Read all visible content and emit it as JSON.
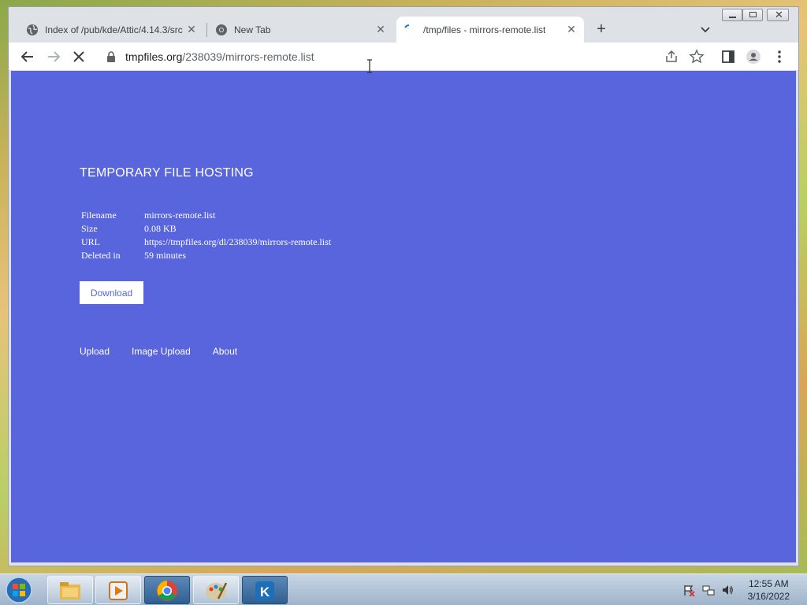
{
  "browser": {
    "tabs": [
      {
        "title": "Index of /pub/kde/Attic/4.14.3/src",
        "favicon": "globe-icon",
        "active": false
      },
      {
        "title": "New Tab",
        "favicon": "chrome-icon",
        "active": false
      },
      {
        "title": "/tmp/files - mirrors-remote.list",
        "favicon": "loading-spinner-icon",
        "active": true
      }
    ],
    "address": {
      "host": "tmpfiles.org",
      "path": "/238039/mirrors-remote.list"
    }
  },
  "page": {
    "title": "TEMPORARY FILE HOSTING",
    "file_info": [
      {
        "label": "Filename",
        "value": "mirrors-remote.list"
      },
      {
        "label": "Size",
        "value": "0.08 KB"
      },
      {
        "label": "URL",
        "value": "https://tmpfiles.org/dl/238039/mirrors-remote.list"
      },
      {
        "label": "Deleted in",
        "value": "59 minutes"
      }
    ],
    "download_label": "Download",
    "footer_links": [
      "Upload",
      "Image Upload",
      "About"
    ],
    "background_color": "#5865dc"
  },
  "taskbar": {
    "apps": [
      "file-manager-icon",
      "media-player-icon",
      "chrome-icon",
      "paint-icon",
      "kde-icon"
    ],
    "clock": {
      "time": "12:55 AM",
      "date": "3/16/2022"
    }
  }
}
